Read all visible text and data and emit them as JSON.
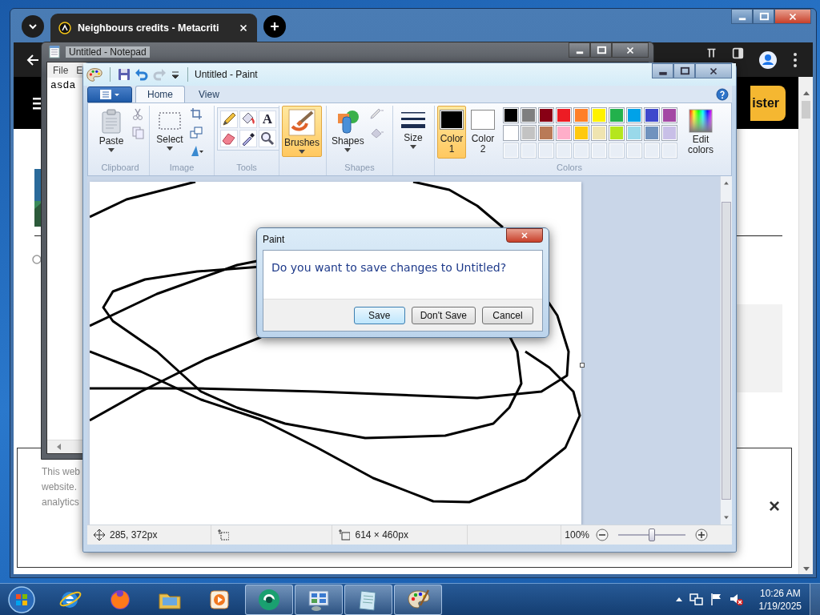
{
  "browser": {
    "tab": {
      "title": "Neighbours credits - Metacriti"
    },
    "header_button": {
      "label": "ister"
    },
    "cookie_banner": {
      "lines": [
        "This web",
        "website.",
        "analytics"
      ],
      "close": "×"
    }
  },
  "notepad": {
    "title": "Untitled - Notepad",
    "menu": [
      "File",
      "E"
    ],
    "text": "asda"
  },
  "paint": {
    "title": "Untitled - Paint",
    "tabs": [
      {
        "label": "Home",
        "selected": true
      },
      {
        "label": "View",
        "selected": false
      }
    ],
    "groups": [
      {
        "label": "Clipboard",
        "tools": [
          {
            "kind": "paste",
            "label": "Paste",
            "selected": false
          },
          {
            "kind": "clipboard_small"
          }
        ]
      },
      {
        "label": "Image",
        "tools": [
          {
            "kind": "select",
            "label": "Select",
            "selected": false
          },
          {
            "kind": "image_small"
          }
        ]
      },
      {
        "label": "Tools",
        "tools": [
          {
            "kind": "grid",
            "text_glyph": "A"
          }
        ]
      },
      {
        "tools": [
          {
            "kind": "brushes",
            "label": "Brushes",
            "selected": true
          }
        ]
      },
      {
        "label": "Shapes",
        "tools": [
          {
            "kind": "shapes",
            "label": "Shapes",
            "selected": false
          },
          {
            "kind": "shape_style"
          }
        ]
      },
      {
        "tools": [
          {
            "kind": "size",
            "label": "Size",
            "selected": false
          }
        ]
      },
      {
        "label": "Colors",
        "tools": [
          {
            "kind": "color",
            "label": "Color 1",
            "color": "#000000",
            "selected": true
          },
          {
            "kind": "color",
            "label": "Color 2",
            "color": "#ffffff",
            "selected": false
          },
          {
            "kind": "palette",
            "colors": [
              {
                "color": "#000000"
              },
              {
                "color": "#7f7f7f"
              },
              {
                "color": "#880015"
              },
              {
                "color": "#ed1c24"
              },
              {
                "color": "#ff7f27"
              },
              {
                "color": "#fff200"
              },
              {
                "color": "#22b14c"
              },
              {
                "color": "#00a2e8"
              },
              {
                "color": "#3f48cc"
              },
              {
                "color": "#a349a4"
              },
              {
                "color": "#ffffff"
              },
              {
                "color": "#c3c3c3"
              },
              {
                "color": "#b97a57"
              },
              {
                "color": "#ffaec9"
              },
              {
                "color": "#ffc90e"
              },
              {
                "color": "#efe4b0"
              },
              {
                "color": "#b5e61d"
              },
              {
                "color": "#99d9ea"
              },
              {
                "color": "#7092be"
              },
              {
                "color": "#c8bfe7"
              }
            ]
          },
          {
            "kind": "edit_colors",
            "label": "Edit colors",
            "selected": false
          }
        ]
      }
    ],
    "status": {
      "cursor": "285, 372px",
      "canvas_size": "614 × 460px",
      "zoom": "100%",
      "level": 0.5
    }
  },
  "dialog": {
    "title": "Paint",
    "message": "Do you want to save changes to Untitled?",
    "buttons": [
      {
        "label": "Save",
        "selected": true
      },
      {
        "label": "Don't Save",
        "selected": false
      },
      {
        "label": "Cancel",
        "selected": false
      }
    ]
  },
  "taskbar": {
    "apps": [
      {
        "kind": "ie",
        "running": false
      },
      {
        "kind": "firefox",
        "running": false
      },
      {
        "kind": "explorer",
        "running": false
      },
      {
        "kind": "media",
        "running": false
      },
      {
        "kind": "circle_app",
        "running": true
      },
      {
        "kind": "control_panel",
        "running": true
      },
      {
        "kind": "notepad",
        "running": true
      },
      {
        "kind": "paint",
        "running": true
      }
    ],
    "time": "10:26 AM",
    "date": "1/19/2025"
  }
}
